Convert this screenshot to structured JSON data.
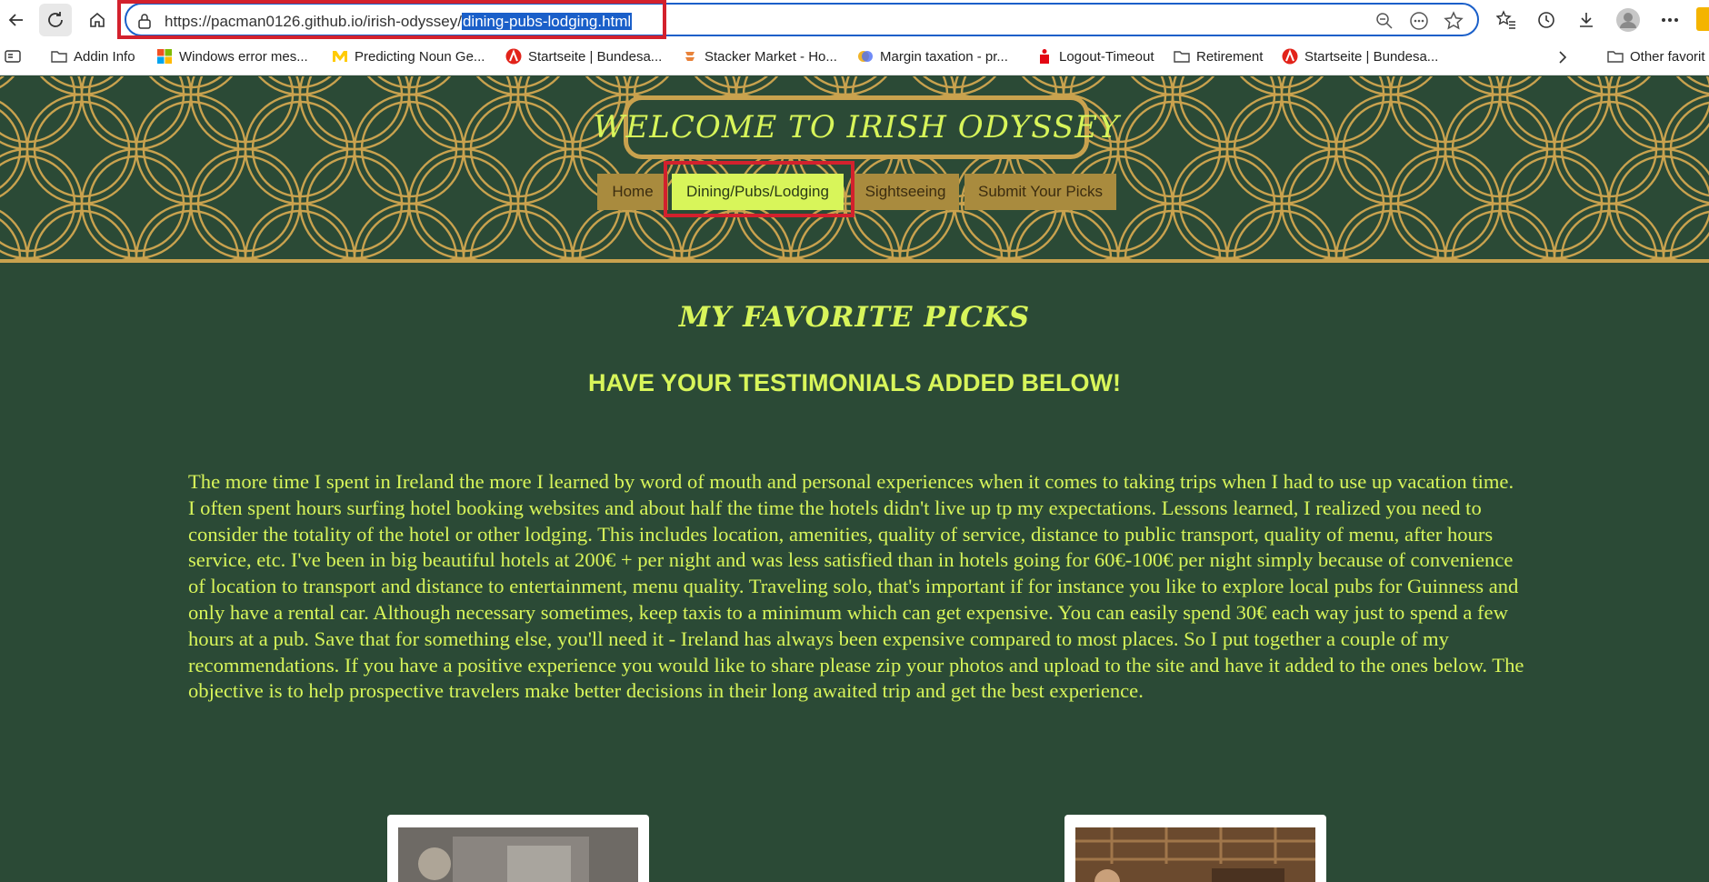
{
  "browser": {
    "url_prefix": "https://pacman0126.github.io/irish-odyssey/",
    "url_selected": "dining-pubs-lodging.html",
    "bookmarks": [
      {
        "label": "Addin Info",
        "icon": "folder-icon"
      },
      {
        "label": "Windows error mes...",
        "icon": "windows-logo-icon"
      },
      {
        "label": "Predicting Noun Ge...",
        "icon": "michigan-logo-icon"
      },
      {
        "label": "Startseite | Bundesa...",
        "icon": "arbeitsagentur-icon"
      },
      {
        "label": "Stacker Market - Ho...",
        "icon": "stacker-icon"
      },
      {
        "label": "Margin taxation - pr...",
        "icon": "margin-icon"
      },
      {
        "label": "Logout-Timeout",
        "icon": "sparkasse-icon"
      },
      {
        "label": "Retirement",
        "icon": "folder-icon"
      },
      {
        "label": "Startseite | Bundesa...",
        "icon": "arbeitsagentur-icon"
      }
    ],
    "other_favorites": "Other favorit"
  },
  "site": {
    "title": "WELCOME TO IRISH ODYSSEY",
    "nav": [
      {
        "label": "Home",
        "active": false
      },
      {
        "label": "Dining/Pubs/Lodging",
        "active": true
      },
      {
        "label": "Sightseeing",
        "active": false
      },
      {
        "label": "Submit Your Picks",
        "active": false
      }
    ]
  },
  "main": {
    "heading": "MY FAVORITE PICKS",
    "subheading": "HAVE YOUR TESTIMONIALS ADDED BELOW!",
    "intro": "The more time I spent in Ireland the more I learned by word of mouth and personal experiences when it comes to taking trips when I had to use up vacation time. I often spent hours surfing hotel booking websites and about half the time the hotels didn't live up tp my expectations. Lessons learned, I realized you need to consider the totality of the hotel or other lodging. This includes location, amenities, quality of service, distance to public transport, quality of menu, after hours service, etc. I've been in big beautiful hotels at 200€ + per night and was less satisfied than in hotels going for 60€-100€ per night simply because of convenience of location to transport and distance to entertainment, menu quality. Traveling solo, that's important if for instance you like to explore local pubs for Guinness and only have a rental car. Although necessary sometimes, keep taxis to a minimum which can get expensive. You can easily spend 30€ each way just to spend a few hours at a pub. Save that for something else, you'll need it - Ireland has always been expensive compared to most places. So I put together a couple of my recommendations. If you have a positive experience you would like to share please zip your photos and upload to the site and have it added to the ones below. The objective is to help prospective travelers make better decisions in their long awaited trip and get the best experience."
  },
  "colors": {
    "page_bg": "#2b4a36",
    "accent": "#d8f55a",
    "gold": "#c9a24e",
    "nav_bg": "#a98b3e",
    "highlight": "#d3212d"
  }
}
